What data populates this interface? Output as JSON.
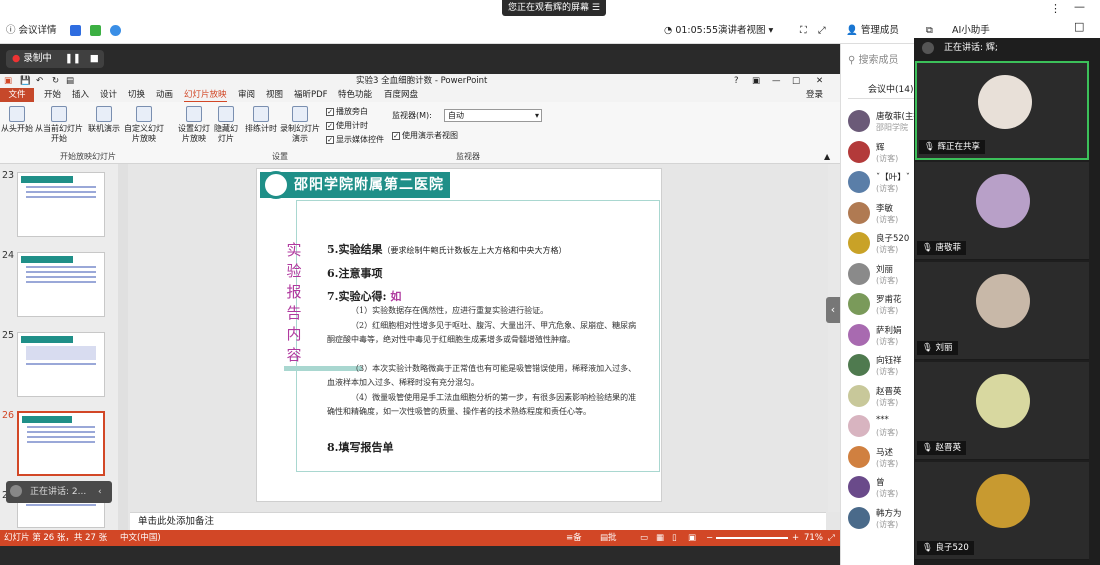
{
  "meeting": {
    "viewing_banner": "您正在观看辉的屏幕",
    "details": "会议详情",
    "timer": "01:05:55",
    "presenter_view": "演讲者视图",
    "manage_members": "管理成员",
    "ai_assistant": "AI小助手"
  },
  "recording": {
    "label": "录制中"
  },
  "ppt": {
    "title": "实验3 全血细胞计数 - PowerPoint",
    "login": "登录",
    "menu": [
      "文件",
      "开始",
      "插入",
      "设计",
      "切换",
      "动画",
      "幻灯片放映",
      "审阅",
      "视图",
      "福昕PDF",
      "特色功能",
      "百度网盘"
    ],
    "ribbon": {
      "from_start": "从头开始",
      "from_current": "从当前幻灯片开始",
      "online": "联机演示",
      "custom": "自定义幻灯片放映",
      "group1": "开始放映幻灯片",
      "setup": "设置幻灯片放映",
      "hide": "隐藏幻灯片",
      "rehearse": "排练计时",
      "record": "录制幻灯片演示",
      "cb_narration": "播放旁白",
      "cb_timing": "使用计时",
      "cb_media": "显示媒体控件",
      "group2": "设置",
      "monitor_label": "监视器(M):",
      "monitor_value": "自动",
      "presenter_cb": "使用演示者视图",
      "group3": "监视器"
    },
    "slide_numbers": [
      "23",
      "24",
      "25",
      "26",
      "27"
    ],
    "toast": "正在讲话: 2...",
    "notes_placeholder": "单击此处添加备注",
    "status": {
      "slide_info": "幻灯片 第 26 张，共 27 张",
      "lang": "中文(中国)",
      "notes": "备注",
      "comments": "批注",
      "zoom": "71%"
    }
  },
  "slide": {
    "banner": "邵阳学院附属第二医院",
    "side_title": [
      "实",
      "验",
      "报",
      "告",
      "内",
      "容"
    ],
    "h5": "5.实验结果",
    "h5_note": "（要求绘制牛鲍氏计数板左上大方格和中央大方格）",
    "h6": "6.注意事项",
    "h7": "7.实验心得:",
    "h7_typed": "如",
    "p1": "（1）实验数据存在偶然性，应进行重复实验进行验证。",
    "p2": "（2）红细胞相对性增多见于呕吐、腹泻、大量出汗、甲亢危象、尿崩症、糖尿病酮症酸中毒等，绝对性中毒见于红细胞生成素增多或骨髓增殖性肿瘤。",
    "p3": "（3）本次实验计数略微高于正常值也有可能是吸管错误使用，稀释液加入过多、血液样本加入过多、稀释时没有充分混匀。",
    "p4": "（4）微量吸管使用是手工法血细胞分析的第一步，有很多因素影响检验结果的准确性和精确度，如一次性吸管的质量、操作者的技术熟练程度和责任心等。",
    "h8": "8.填写报告单"
  },
  "members": {
    "search_placeholder": "搜索成员",
    "in_meeting": "会议中(14)",
    "list": [
      {
        "name": "唐敬菲(主持",
        "role": "邵阳学院",
        "color": "#6b5a78"
      },
      {
        "name": "辉",
        "role": "(访客)",
        "color": "#b33a3a"
      },
      {
        "name": "ˇ【叶】ˇ",
        "role": "(访客)",
        "color": "#5a7ea8"
      },
      {
        "name": "李敏",
        "role": "(访客)",
        "color": "#b07a52"
      },
      {
        "name": "良子520",
        "role": "(访客)",
        "color": "#c9a227"
      },
      {
        "name": "刘丽",
        "role": "(访客)",
        "color": "#8a8a8a"
      },
      {
        "name": "罗甫花",
        "role": "(访客)",
        "color": "#7a9a5a"
      },
      {
        "name": "萨利娟",
        "role": "(访客)",
        "color": "#a86ab0"
      },
      {
        "name": "向钰祥",
        "role": "(访客)",
        "color": "#4f7a4f"
      },
      {
        "name": "赵晋英",
        "role": "(访客)",
        "color": "#c8c89a"
      },
      {
        "name": "***",
        "role": "(访客)",
        "color": "#d8b4c0"
      },
      {
        "name": "马述",
        "role": "(访客)",
        "color": "#d08040"
      },
      {
        "name": "曾",
        "role": "(访客)",
        "color": "#6a4a8a"
      },
      {
        "name": "韩方为",
        "role": "(访客)",
        "color": "#4a6a8a"
      }
    ]
  },
  "video": {
    "speaking": "正在讲话: 辉;",
    "tiles": [
      {
        "name": "辉正在共享",
        "color": "#e8e0d8"
      },
      {
        "name": "唐敬菲",
        "color": "#b8a0c8"
      },
      {
        "name": "刘丽",
        "color": "#c8b8a8"
      },
      {
        "name": "赵晋英",
        "color": "#d8d8a0"
      },
      {
        "name": "良子520",
        "color": "#c89a30"
      }
    ]
  }
}
